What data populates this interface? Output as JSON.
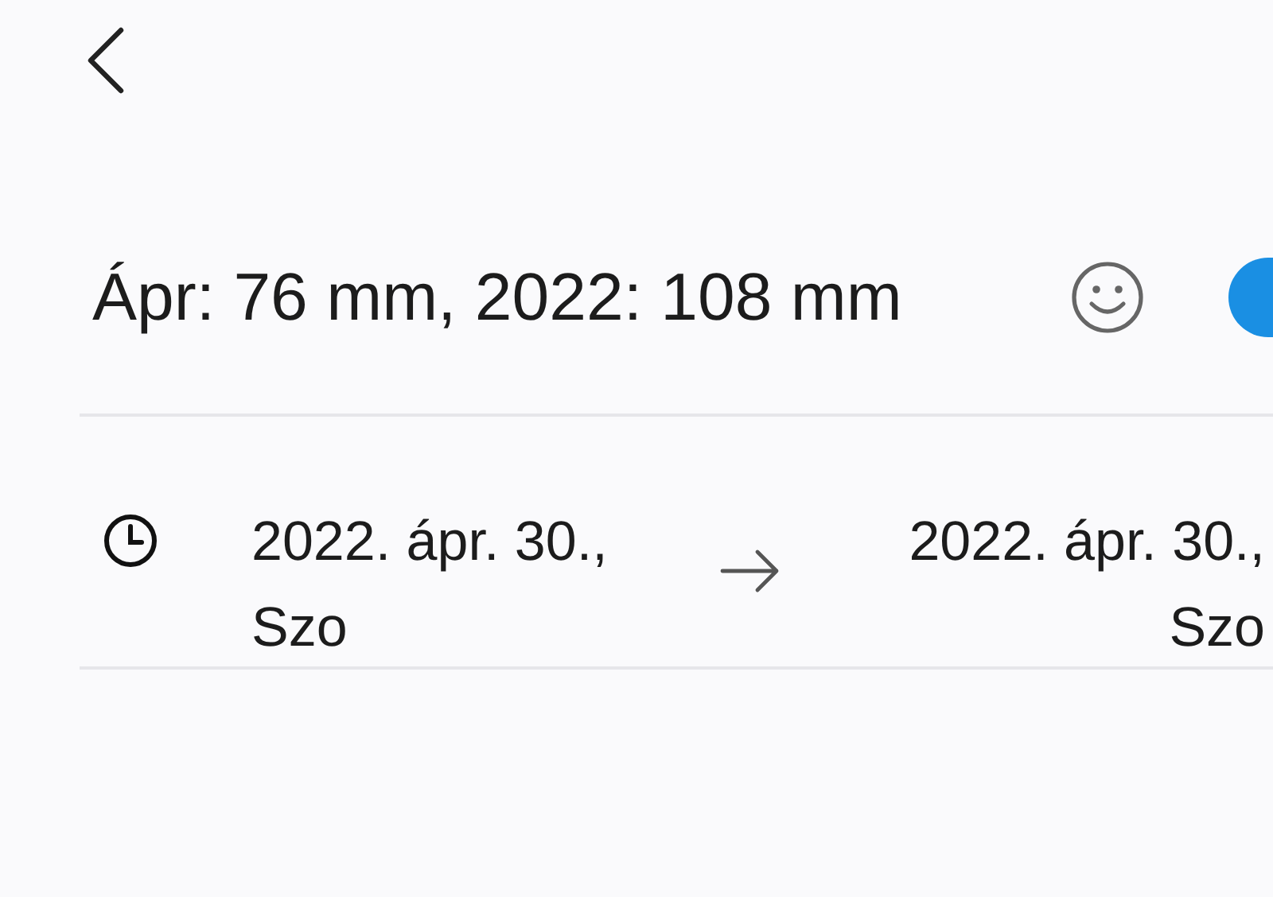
{
  "event": {
    "title": "Ápr: 76 mm, 2022: 108 mm",
    "color": "#1a8fe3"
  },
  "time": {
    "start": "2022. ápr. 30., Szo",
    "end": "2022. ápr. 30., Szo"
  }
}
